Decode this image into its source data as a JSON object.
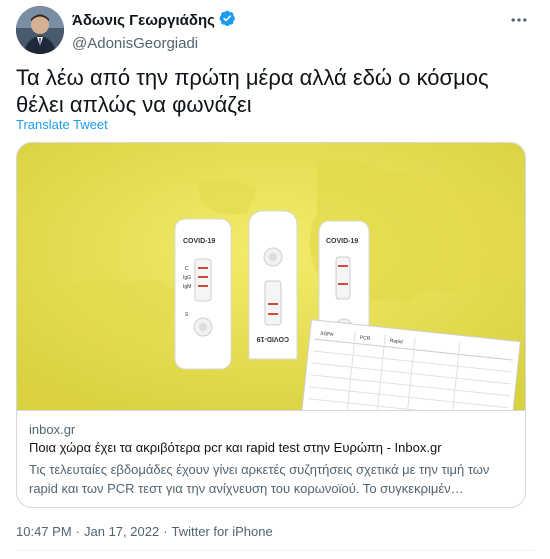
{
  "author": {
    "display_name": "Άδωνις Γεωργιάδης",
    "handle": "@AdonisGeorgiadi",
    "verified": true
  },
  "more_icon": "more-horizontal-icon",
  "tweet": {
    "text": "Τα λέω από την πρώτη μέρα αλλά εδώ ο κόσμος θέλει απλώς να φωνάζει",
    "translate_label": "Translate Tweet"
  },
  "card": {
    "image": {
      "test_label_1": "COVID-19",
      "test_label_2": "COVID-19",
      "test_label_3": "COVID-19",
      "marks_c": "C",
      "marks_igg": "IgG",
      "marks_igm": "IgM",
      "marks_s": "S",
      "table_headers": [
        "ΧΩΡΑ",
        "PCR",
        "Rapid"
      ]
    },
    "domain": "inbox.gr",
    "title": "Ποια χώρα έχει τα ακριβότερα pcr και rapid test στην Ευρώπη - Inbox.gr",
    "description": "Τις τελευταίες εβδομάδες έχουν γίνει αρκετές συζητήσεις σχετικά με την τιμή των rapid και των PCR τεστ για την ανίχνευση του κορωνοϊού. Το συγκεκριμέν…"
  },
  "meta": {
    "time": "10:47 PM",
    "separator": "·",
    "date": "Jan 17, 2022",
    "source": "Twitter for iPhone"
  },
  "colors": {
    "accent": "#1d9bf0",
    "text": "#0f1419",
    "secondary": "#536471",
    "card_bg": "#e9e35a"
  }
}
